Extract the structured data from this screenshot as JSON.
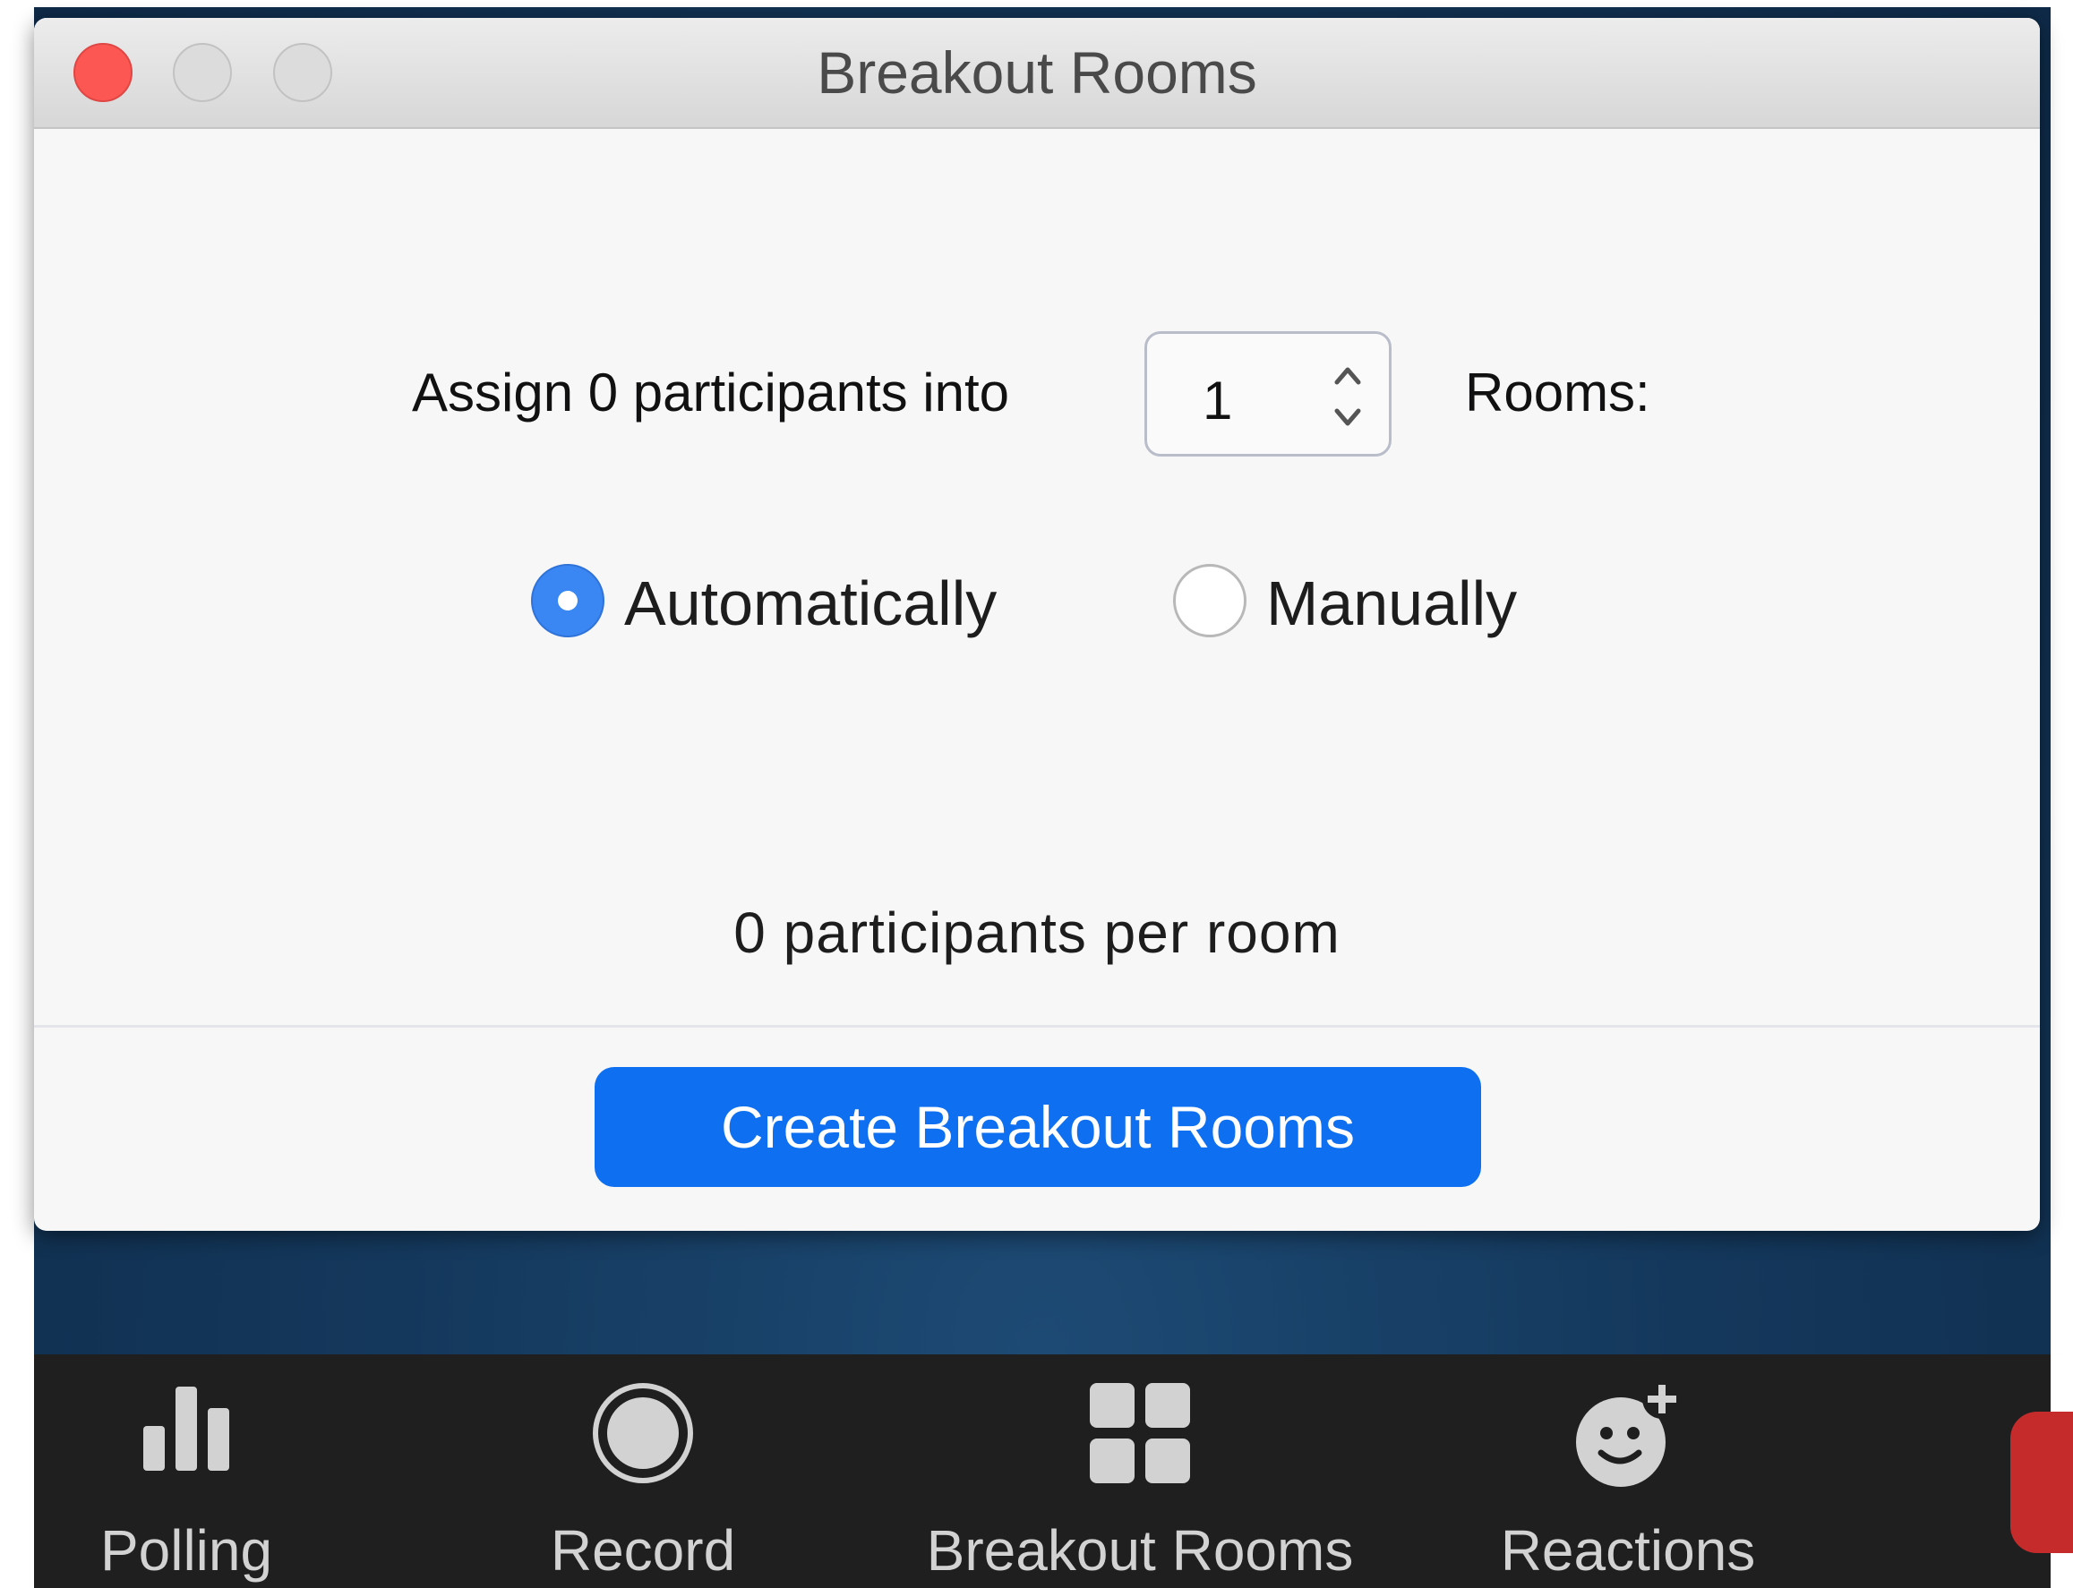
{
  "window": {
    "title": "Breakout Rooms"
  },
  "assign": {
    "prefix": "Assign 0 participants into",
    "rooms_value": "1",
    "suffix": "Rooms:"
  },
  "assignment_mode": {
    "options": [
      {
        "label": "Automatically",
        "selected": true
      },
      {
        "label": "Manually",
        "selected": false
      }
    ]
  },
  "summary": {
    "per_room": "0 participants per room"
  },
  "actions": {
    "create_label": "Create Breakout Rooms"
  },
  "toolbar": {
    "items": [
      {
        "label": "Polling",
        "icon": "polling-icon"
      },
      {
        "label": "Record",
        "icon": "record-icon"
      },
      {
        "label": "Breakout Rooms",
        "icon": "breakout-rooms-icon"
      },
      {
        "label": "Reactions",
        "icon": "reactions-icon"
      }
    ]
  },
  "colors": {
    "accent": "#0e6ff0",
    "radio_selected": "#3a87f3",
    "close_button": "#fc5753",
    "toolbar_bg": "#1f1f1f",
    "end_button": "#c62b2b"
  }
}
